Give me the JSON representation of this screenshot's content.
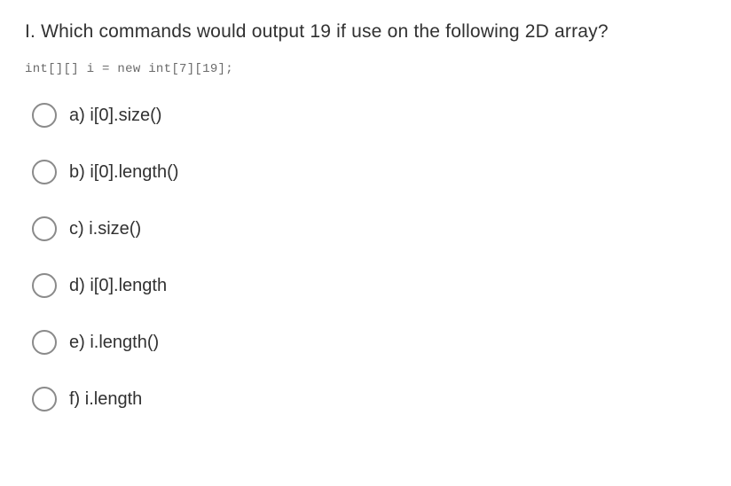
{
  "question": {
    "title": "I. Which commands would output 19 if use on the following 2D array?",
    "code": "int[][] i = new int[7][19];"
  },
  "options": [
    {
      "label": "a) i[0].size()"
    },
    {
      "label": "b) i[0].length()"
    },
    {
      "label": "c) i.size()"
    },
    {
      "label": "d) i[0].length"
    },
    {
      "label": "e) i.length()"
    },
    {
      "label": "f) i.length"
    }
  ]
}
